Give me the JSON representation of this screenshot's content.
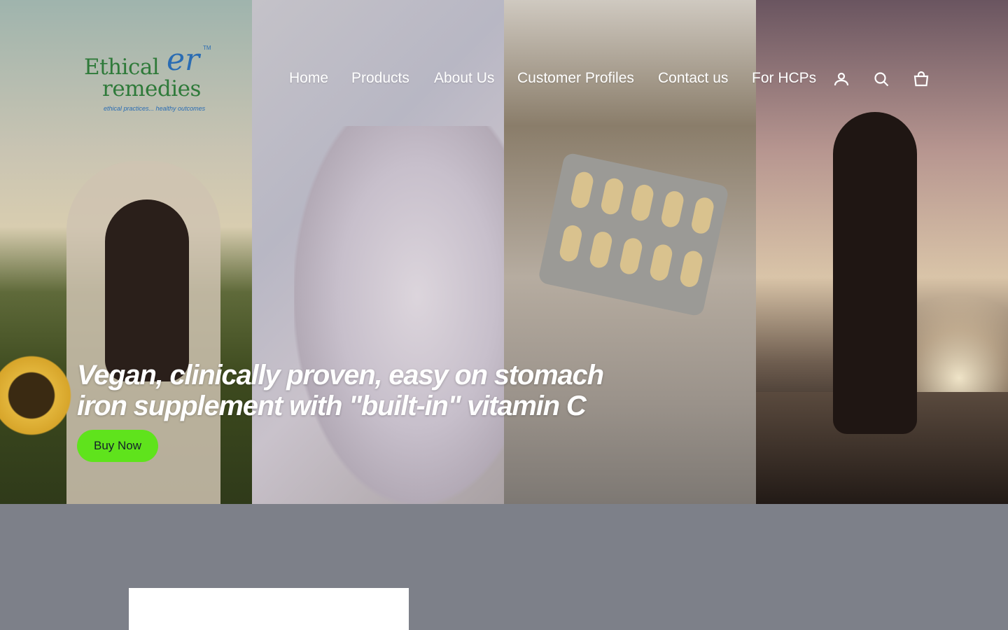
{
  "brand": {
    "name_line1": "Ethical",
    "name_line2": "remedies",
    "monogram": "er",
    "trademark": "TM",
    "tagline": "ethical practices... healthy outcomes"
  },
  "nav": {
    "items": [
      {
        "label": "Home"
      },
      {
        "label": "Products"
      },
      {
        "label": "About Us"
      },
      {
        "label": "Customer Profiles"
      },
      {
        "label": "Contact us"
      },
      {
        "label": "For HCPs"
      }
    ],
    "icons": [
      "account-icon",
      "search-icon",
      "cart-icon"
    ]
  },
  "hero": {
    "headline": "Vegan, clinically proven, easy on stomach iron supplement with \"built-in\" vitamin C",
    "cta_label": "Buy Now",
    "panels": [
      "woman-in-sunflower-field",
      "pregnant-woman",
      "hands-holding-capsule-blister",
      "woman-silhouette-at-beach"
    ]
  },
  "colors": {
    "cta_background": "#5fe31c",
    "page_background": "#7d8089",
    "logo_green": "#2f7a3a",
    "logo_blue": "#2a6cb3"
  }
}
